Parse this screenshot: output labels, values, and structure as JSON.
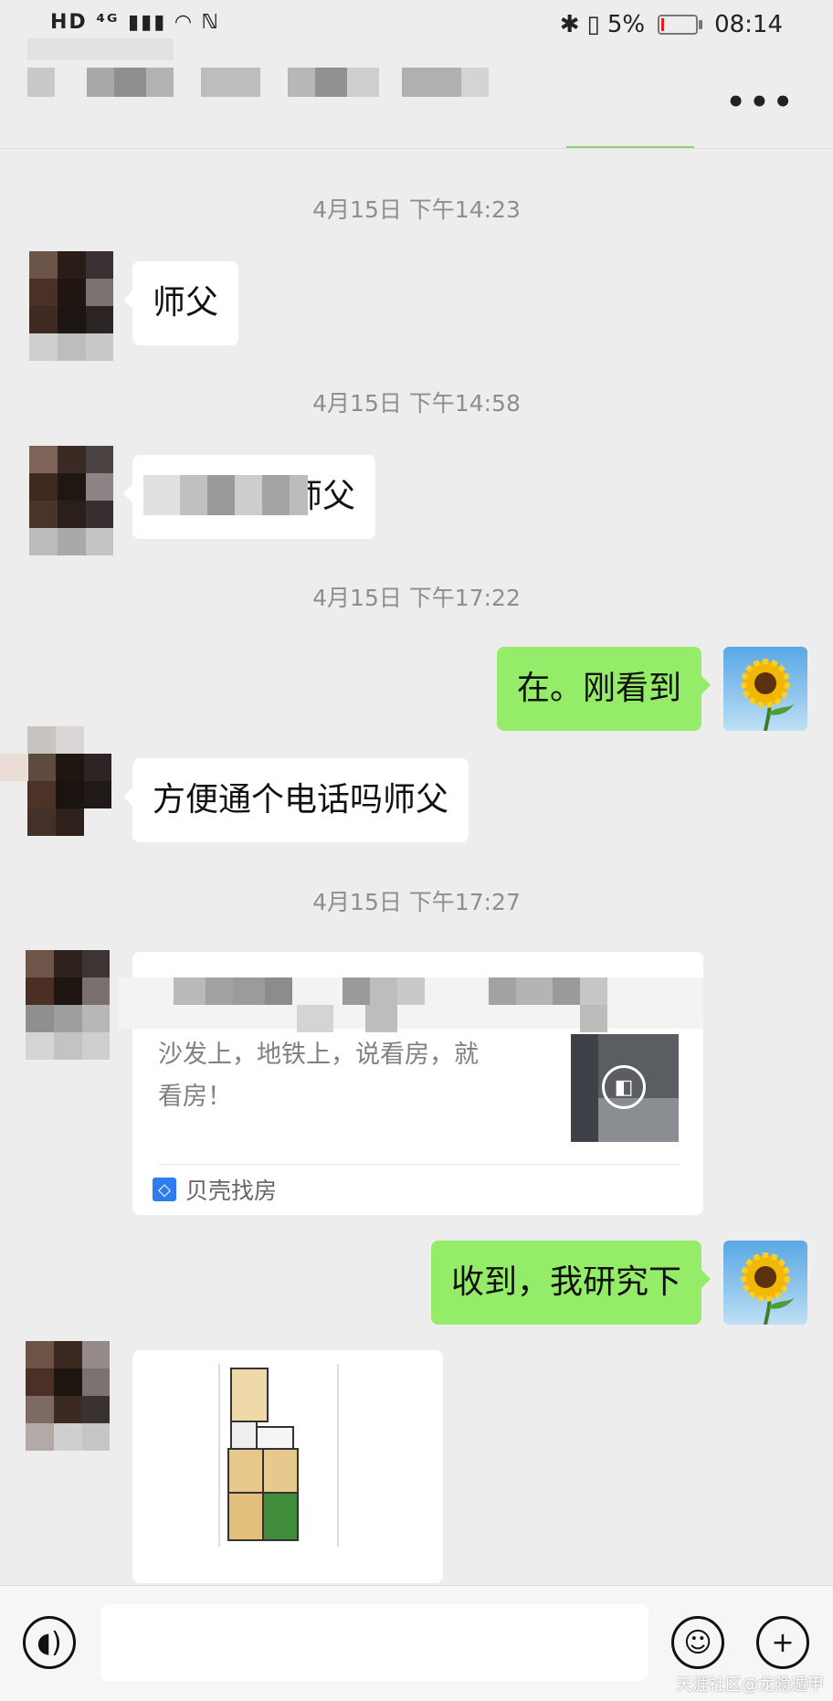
{
  "status_bar": {
    "left": "HD ⁴ᴳ ▮▮▮ ◠ ℕ",
    "battery_percent": "5%",
    "time": "08:14"
  },
  "header": {
    "more_label": "•••"
  },
  "messages": [
    {
      "time": "4月15日 下午14:23",
      "text": "师父"
    },
    {
      "time": "4月15日 下午14:58",
      "text": "师父"
    },
    {
      "time": "4月15日 下午17:22",
      "text": "在。刚看到"
    },
    {
      "text": "方便通个电话吗师父"
    },
    {
      "time": "4月15日 下午17:27",
      "card": {
        "desc_line1": "沙发上，地铁上，说看房，就",
        "desc_line2": "看房！",
        "source": "贝壳找房"
      }
    },
    {
      "text": "收到，我研究下"
    }
  ],
  "input": {
    "voice_icon": "voice-icon",
    "emoji_icon": "emoji-icon",
    "plus_icon": "plus-icon"
  },
  "watermark": "天涯社区@龙隐遁甲",
  "colors": {
    "sent_bubble": "#95ec69",
    "background": "#ededed"
  }
}
